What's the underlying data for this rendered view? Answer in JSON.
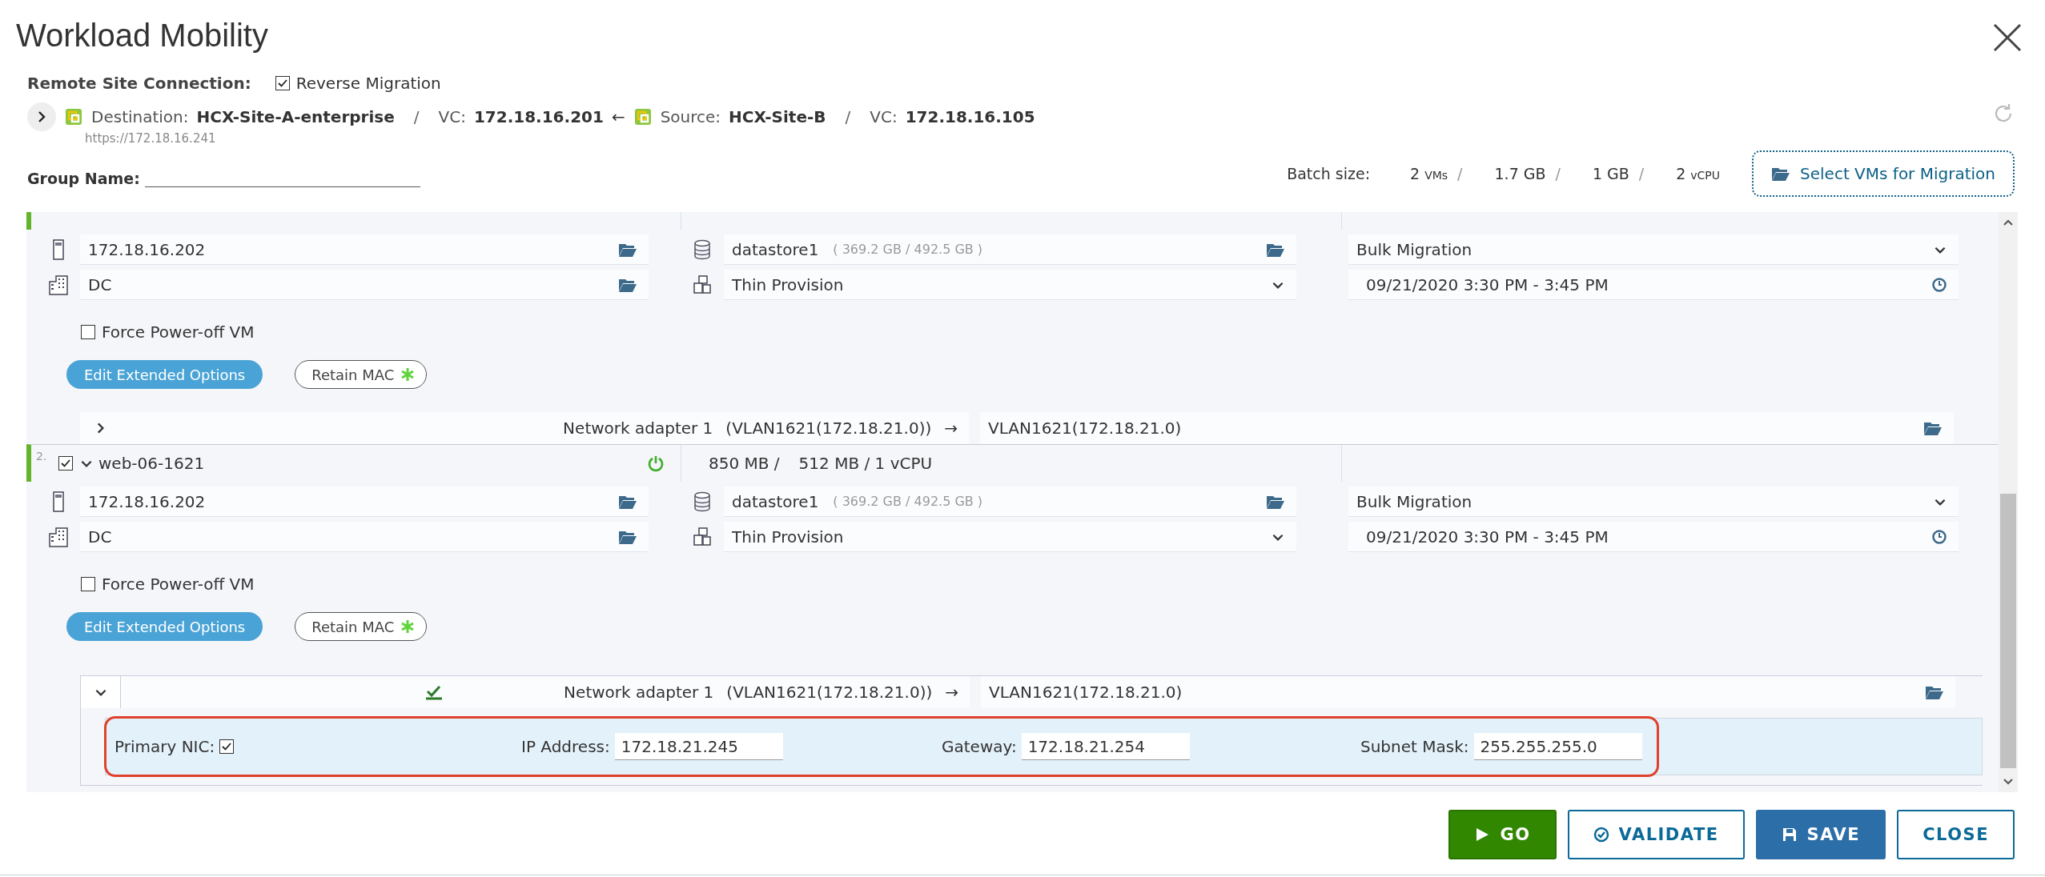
{
  "window": {
    "title": "Workload Mobility"
  },
  "remote_site": {
    "label": "Remote Site Connection:",
    "reverse_migration": {
      "label": "Reverse Migration",
      "checked": true
    }
  },
  "connection": {
    "destination_label": "Destination:",
    "destination": "HCX-Site-A-enterprise",
    "dest_vc_label": "VC:",
    "dest_vc": "172.18.16.201",
    "separator": "/",
    "arrow": "←",
    "source_label": "Source:",
    "source": "HCX-Site-B",
    "source_separator": "/",
    "source_vc_label": "VC:",
    "source_vc": "172.18.16.105",
    "url": "https://172.18.16.241"
  },
  "group_name": {
    "label": "Group Name:"
  },
  "batch": {
    "label": "Batch size:",
    "items": [
      {
        "value": "2",
        "unit": "VMs",
        "separator": "/"
      },
      {
        "value": "1.7 GB",
        "separator": "/"
      },
      {
        "value": "1 GB",
        "separator": "/"
      },
      {
        "value": "2",
        "unit": "vCPU"
      }
    ]
  },
  "select_button": {
    "label": "Select VMs for Migration"
  },
  "vms": [
    {
      "host": "172.18.16.202",
      "folder": "DC",
      "datastore": "datastore1",
      "datastore_capacity": "( 369.2 GB / 492.5 GB )",
      "disk_format": "Thin Provision",
      "migration_type": "Bulk Migration",
      "schedule": "09/21/2020 3:30 PM - 3:45 PM",
      "force_power_off": {
        "label": "Force Power-off VM",
        "checked": false
      },
      "edit_button": "Edit Extended Options",
      "retain_mac": "Retain MAC",
      "network": {
        "expanded": false,
        "validated": false,
        "label": "Network adapter 1",
        "source": "(VLAN1621(172.18.21.0))",
        "arrow": "→",
        "target": "VLAN1621(172.18.21.0)"
      }
    },
    {
      "header": {
        "number": "2.",
        "checked": true,
        "expanded": true,
        "name": "web-06-1621",
        "powered_on": true,
        "storage": "850 MB /",
        "memory_cpu": "512 MB / 1 vCPU"
      },
      "host": "172.18.16.202",
      "folder": "DC",
      "datastore": "datastore1",
      "datastore_capacity": "( 369.2 GB / 492.5 GB )",
      "disk_format": "Thin Provision",
      "migration_type": "Bulk Migration",
      "schedule": "09/21/2020 3:30 PM - 3:45 PM",
      "force_power_off": {
        "label": "Force Power-off VM",
        "checked": false
      },
      "edit_button": "Edit Extended Options",
      "retain_mac": "Retain MAC",
      "network": {
        "expanded": true,
        "validated": true,
        "label": "Network adapter 1",
        "source": "(VLAN1621(172.18.21.0))",
        "arrow": "→",
        "target": "VLAN1621(172.18.21.0)",
        "nic": {
          "highlighted": true,
          "primary_label": "Primary NIC:",
          "primary_checked": true,
          "ip_label": "IP Address:",
          "ip": "172.18.21.245",
          "gateway_label": "Gateway:",
          "gateway": "172.18.21.254",
          "mask_label": "Subnet Mask:",
          "mask": "255.255.255.0"
        }
      }
    }
  ],
  "footer_buttons": [
    {
      "kind": "go",
      "label": "GO"
    },
    {
      "kind": "validate",
      "label": "VALIDATE"
    },
    {
      "kind": "save",
      "label": "SAVE"
    },
    {
      "kind": "close",
      "label": "CLOSE"
    }
  ]
}
